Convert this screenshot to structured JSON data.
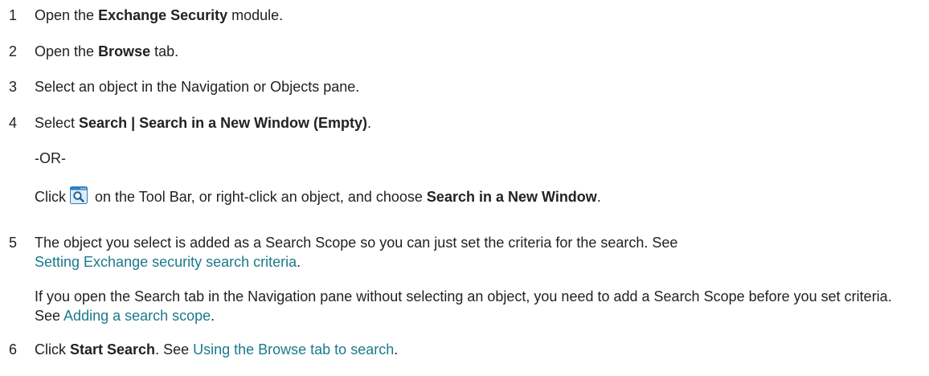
{
  "steps": [
    {
      "num": "1",
      "pre": "Open the ",
      "bold": "Exchange Security",
      "post": " module."
    },
    {
      "num": "2",
      "pre": "Open the ",
      "bold": "Browse",
      "post": " tab."
    },
    {
      "num": "3",
      "text": "Select an object in the Navigation or Objects pane."
    },
    {
      "num": "4",
      "pre": "Select ",
      "bold": "Search | Search in a New Window (Empty)",
      "post": "."
    },
    {
      "num": "5",
      "text": "The object you select is added as a Search Scope so you can just set the criteria for the search. See",
      "link": "Setting Exchange security search criteria",
      "post": "."
    },
    {
      "num": "6",
      "pre": "Click ",
      "bold": "Start Search",
      "mid": ". See ",
      "link": "Using the Browse tab to search",
      "post": "."
    }
  ],
  "or_text": "-OR-",
  "click_line": {
    "pre": "Click ",
    "icon": "search-window-icon",
    "mid": " on the Tool Bar, or right-click an object, and choose ",
    "bold": "Search in a New Window",
    "post": "."
  },
  "note": {
    "text": "If you open the Search tab in the Navigation pane without selecting an object, you need to add a Search Scope before you set criteria. See ",
    "link": "Adding a search scope",
    "post": "."
  },
  "colors": {
    "link": "#1a7a8c",
    "icon_blue": "#2a7fc1"
  }
}
